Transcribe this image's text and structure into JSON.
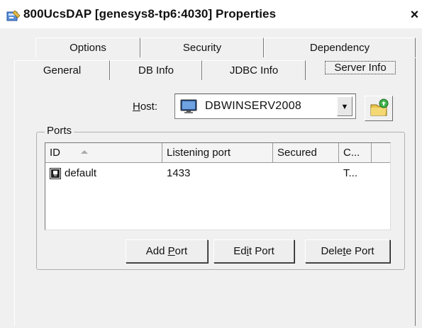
{
  "window": {
    "title": "800UcsDAP [genesys8-tp6:4030] Properties",
    "close_glyph": "×"
  },
  "tabs_row1": [
    "Options",
    "Security",
    "Dependency"
  ],
  "tabs_row2": [
    "General",
    "DB Info",
    "JDBC Info",
    "Server Info"
  ],
  "active_tab": "Server Info",
  "host": {
    "label_accel": "H",
    "label_rest": "ost:",
    "value": "DBWINSERV2008",
    "arrow_glyph": "▼"
  },
  "ports": {
    "legend": "Ports",
    "columns": [
      "ID",
      "Listening port",
      "Secured",
      "C..."
    ],
    "rows": [
      {
        "id": "default",
        "port": "1433",
        "secured": "",
        "c": "T..."
      }
    ]
  },
  "buttons": {
    "add_port": {
      "pre": "Add ",
      "accel": "P",
      "post": "ort"
    },
    "edit_port": {
      "pre": "Ed",
      "accel": "i",
      "post": "t Port"
    },
    "delete_port": {
      "pre": "Dele",
      "accel": "t",
      "post": "e Port"
    }
  },
  "icons": {
    "title": "properties-icon",
    "host": "monitor-icon",
    "refresh": "folder-refresh-icon",
    "row": "port-icon"
  }
}
